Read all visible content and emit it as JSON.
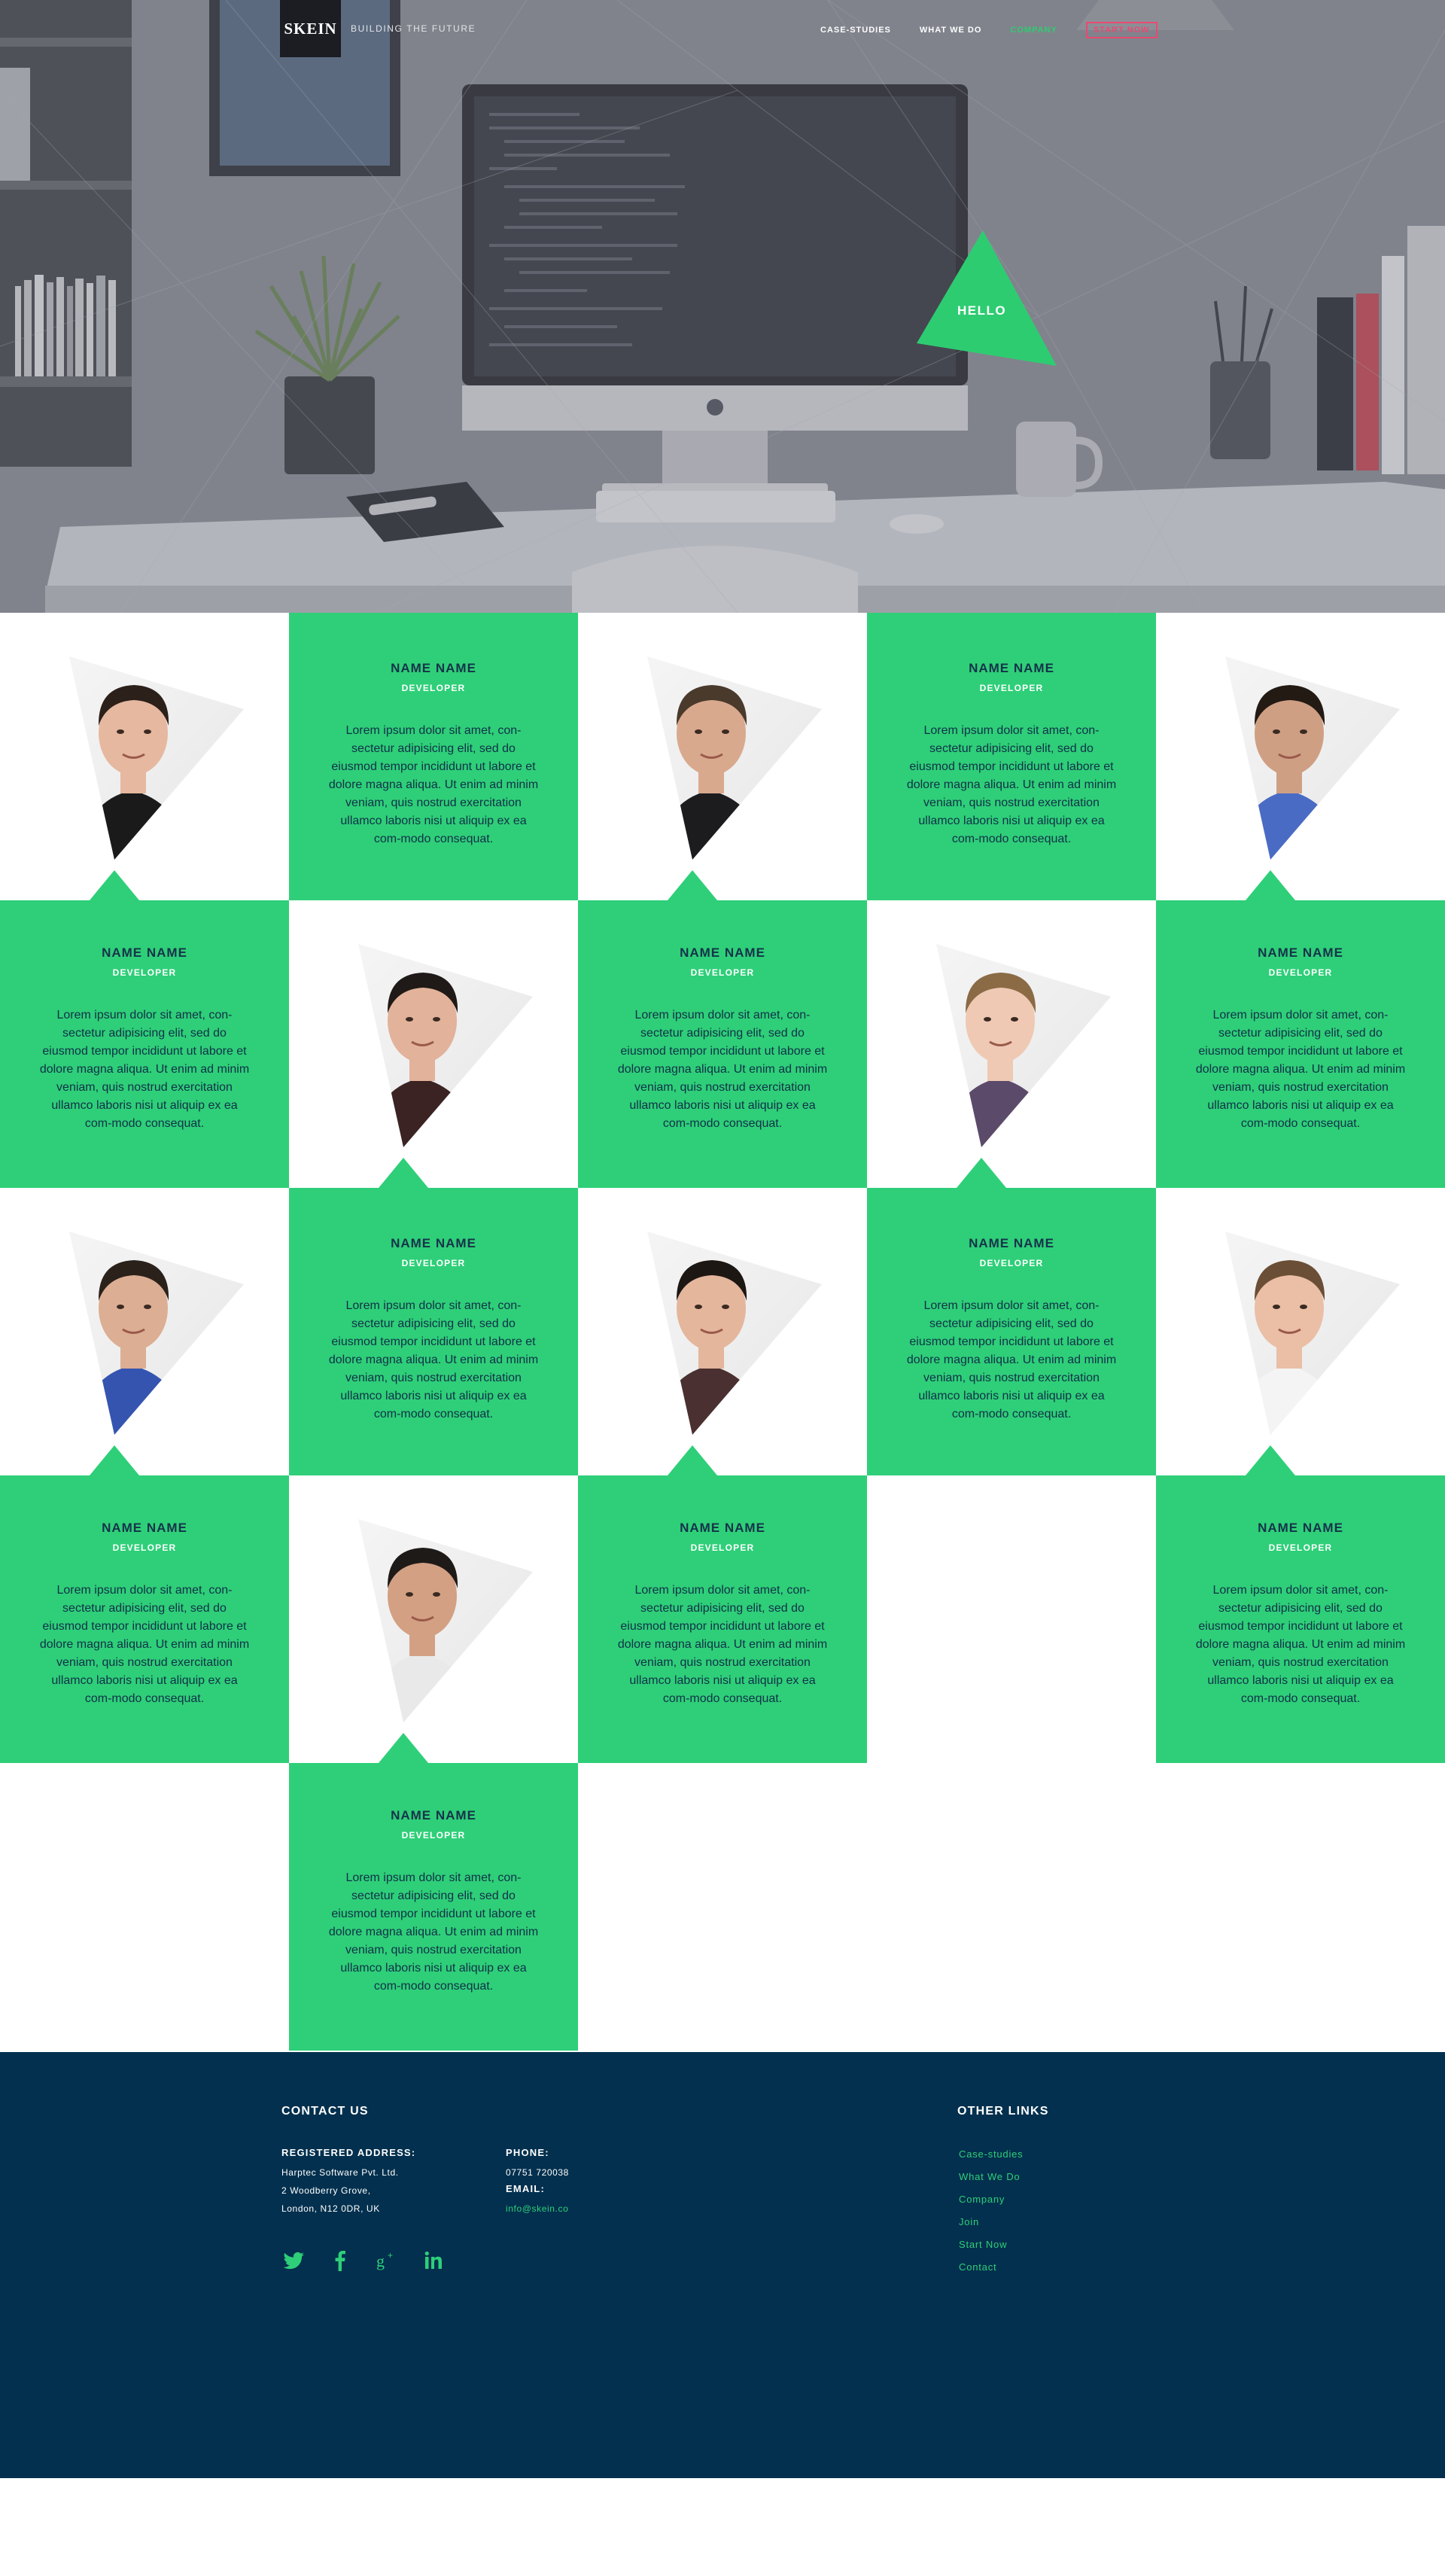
{
  "header": {
    "logo": "SKEIN",
    "tagline": "BUILDING THE FUTURE",
    "nav": [
      {
        "label": "CASE-STUDIES",
        "state": "default"
      },
      {
        "label": "WHAT WE DO",
        "state": "default"
      },
      {
        "label": "COMPANY",
        "state": "active"
      },
      {
        "label": "START NOW",
        "state": "cta"
      }
    ]
  },
  "hero": {
    "hello": "HELLO"
  },
  "team": [
    {
      "name": "NAME NAME",
      "role": "DEVELOPER",
      "bio": "Lorem ipsum dolor sit amet, con-sectetur adipisicing elit, sed do eiusmod tempor incididunt ut labore et dolore magna aliqua. Ut enim ad minim veniam, quis nostrud exercitation ullamco laboris nisi ut aliquip ex ea com-modo consequat."
    },
    {
      "name": "NAME NAME",
      "role": "DEVELOPER",
      "bio": "Lorem ipsum dolor sit amet, con-sectetur adipisicing elit, sed do eiusmod tempor incididunt ut labore et dolore magna aliqua. Ut enim ad minim veniam, quis nostrud exercitation ullamco laboris nisi ut aliquip ex ea com-modo consequat."
    },
    {
      "name": "NAME NAME",
      "role": "DEVELOPER",
      "bio": "Lorem ipsum dolor sit amet, con-sectetur adipisicing elit, sed do eiusmod tempor incididunt ut labore et dolore magna aliqua. Ut enim ad minim veniam, quis nostrud exercitation ullamco laboris nisi ut aliquip ex ea com-modo consequat."
    },
    {
      "name": "NAME NAME",
      "role": "DEVELOPER",
      "bio": "Lorem ipsum dolor sit amet, con-sectetur adipisicing elit, sed do eiusmod tempor incididunt ut labore et dolore magna aliqua. Ut enim ad minim veniam, quis nostrud exercitation ullamco laboris nisi ut aliquip ex ea com-modo consequat."
    },
    {
      "name": "NAME NAME",
      "role": "DEVELOPER",
      "bio": "Lorem ipsum dolor sit amet, con-sectetur adipisicing elit, sed do eiusmod tempor incididunt ut labore et dolore magna aliqua. Ut enim ad minim veniam, quis nostrud exercitation ullamco laboris nisi ut aliquip ex ea com-modo consequat."
    },
    {
      "name": "NAME NAME",
      "role": "DEVELOPER",
      "bio": "Lorem ipsum dolor sit amet, con-sectetur adipisicing elit, sed do eiusmod tempor incididunt ut labore et dolore magna aliqua. Ut enim ad minim veniam, quis nostrud exercitation ullamco laboris nisi ut aliquip ex ea com-modo consequat."
    },
    {
      "name": "NAME NAME",
      "role": "DEVELOPER",
      "bio": "Lorem ipsum dolor sit amet, con-sectetur adipisicing elit, sed do eiusmod tempor incididunt ut labore et dolore magna aliqua. Ut enim ad minim veniam, quis nostrud exercitation ullamco laboris nisi ut aliquip ex ea com-modo consequat."
    },
    {
      "name": "NAME NAME",
      "role": "DEVELOPER",
      "bio": "Lorem ipsum dolor sit amet, con-sectetur adipisicing elit, sed do eiusmod tempor incididunt ut labore et dolore magna aliqua. Ut enim ad minim veniam, quis nostrud exercitation ullamco laboris nisi ut aliquip ex ea com-modo consequat."
    },
    {
      "name": "NAME NAME",
      "role": "DEVELOPER",
      "bio": "Lorem ipsum dolor sit amet, con-sectetur adipisicing elit, sed do eiusmod tempor incididunt ut labore et dolore magna aliqua. Ut enim ad minim veniam, quis nostrud exercitation ullamco laboris nisi ut aliquip ex ea com-modo consequat."
    },
    {
      "name": "NAME NAME",
      "role": "DEVELOPER",
      "bio": "Lorem ipsum dolor sit amet, con-sectetur adipisicing elit, sed do eiusmod tempor incididunt ut labore et dolore magna aliqua. Ut enim ad minim veniam, quis nostrud exercitation ullamco laboris nisi ut aliquip ex ea com-modo consequat."
    },
    {
      "name": "NAME NAME",
      "role": "DEVELOPER",
      "bio": "Lorem ipsum dolor sit amet, con-sectetur adipisicing elit, sed do eiusmod tempor incididunt ut labore et dolore magna aliqua. Ut enim ad minim veniam, quis nostrud exercitation ullamco laboris nisi ut aliquip ex ea com-modo consequat."
    }
  ],
  "footer": {
    "contact_title": "CONTACT US",
    "address_label": "REGISTERED ADDRESS:",
    "address_lines": [
      "Harptec Software Pvt. Ltd.",
      "2 Woodberry Grove,",
      "London, N12 0DR, UK"
    ],
    "phone_label": "PHONE:",
    "phone": "07751 720038",
    "email_label": "EMAIL:",
    "email": "info@skein.co",
    "social": [
      "twitter-icon",
      "facebook-icon",
      "google-plus-icon",
      "linkedin-icon"
    ],
    "links_title": "OTHER LINKS",
    "links": [
      "Case-studies",
      "What We Do",
      "Company",
      "Join",
      "Start Now",
      "Contact"
    ]
  },
  "colors": {
    "green": "#2ecf78",
    "navy": "#03304e",
    "pink": "#e84a71"
  }
}
